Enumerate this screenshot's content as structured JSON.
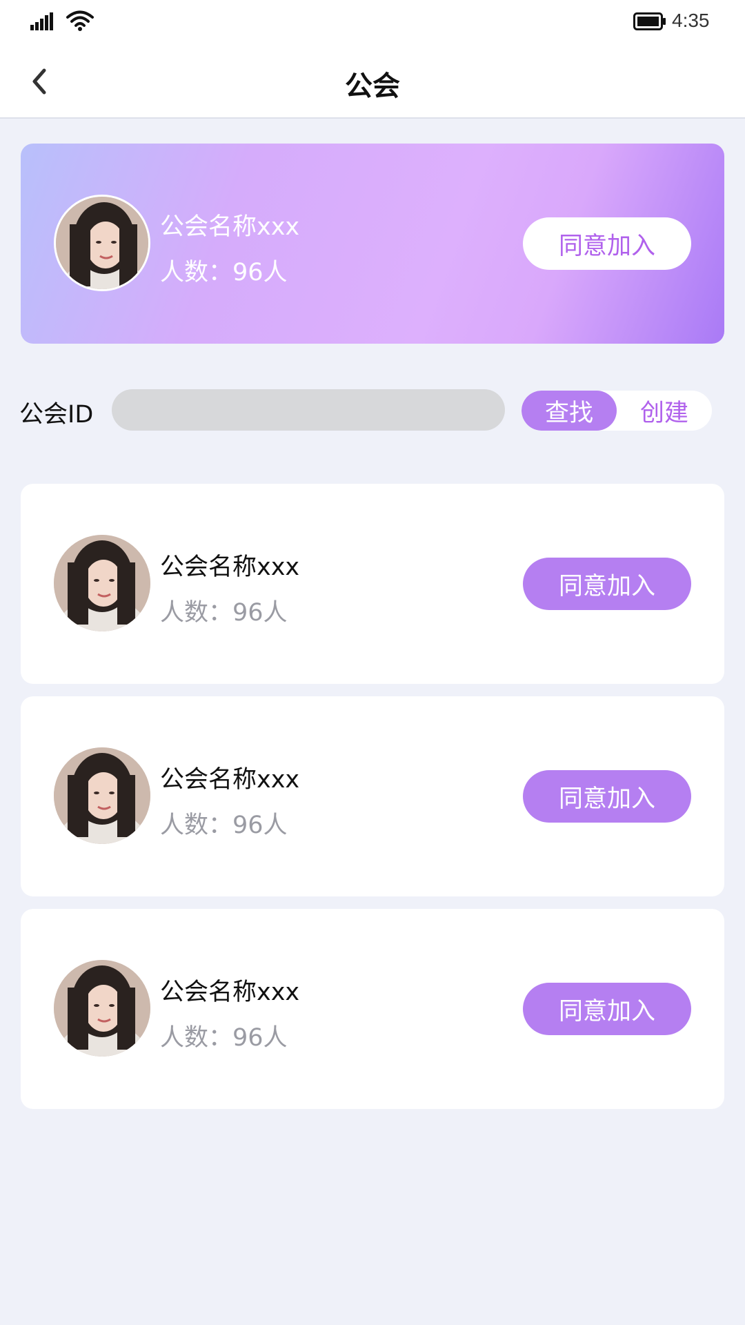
{
  "status_bar": {
    "time": "4:35"
  },
  "nav": {
    "title": "公会"
  },
  "invite": {
    "name": "公会名称xxx",
    "count": "人数：96人",
    "join_label": "同意加入"
  },
  "search": {
    "label": "公会ID",
    "placeholder": "",
    "search_label": "查找",
    "create_label": "创建"
  },
  "guilds": [
    {
      "name": "公会名称xxx",
      "count": "人数：96人",
      "join_label": "同意加入"
    },
    {
      "name": "公会名称xxx",
      "count": "人数：96人",
      "join_label": "同意加入"
    },
    {
      "name": "公会名称xxx",
      "count": "人数：96人",
      "join_label": "同意加入"
    }
  ],
  "colors": {
    "accent": "#b57ff1",
    "accent_text": "#b061ec",
    "background": "#eff1f9"
  }
}
